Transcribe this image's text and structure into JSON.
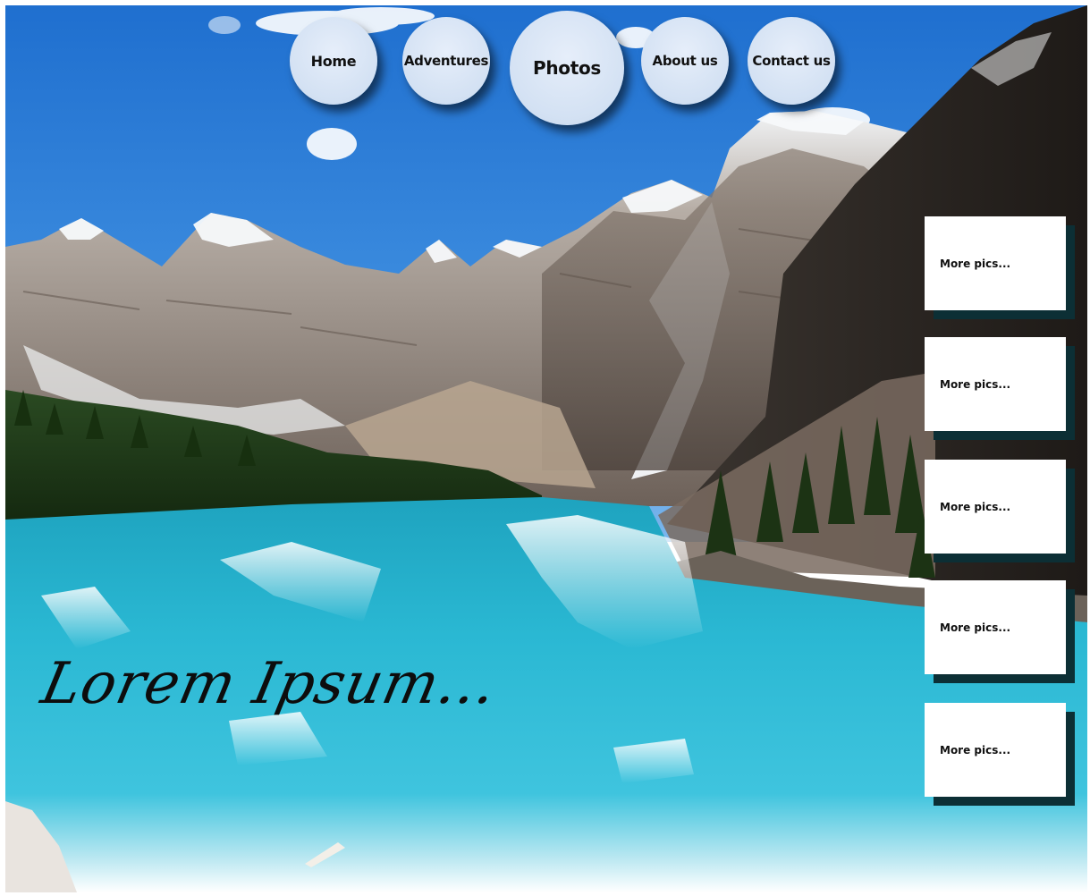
{
  "nav": {
    "items": [
      {
        "label": "Home",
        "active": false
      },
      {
        "label": "Adventures",
        "active": false
      },
      {
        "label": "Photos",
        "active": true
      },
      {
        "label": "About us",
        "active": false
      },
      {
        "label": "Contact us",
        "active": false
      }
    ]
  },
  "hero": {
    "headline": "Lorem Ipsum..."
  },
  "side_panel": {
    "cards": [
      {
        "label": "More pics..."
      },
      {
        "label": "More pics..."
      },
      {
        "label": "More pics..."
      },
      {
        "label": "More pics..."
      },
      {
        "label": "More pics..."
      }
    ]
  },
  "colors": {
    "sky": "#2f7fd6",
    "lake": "#2bb8d2",
    "nav_button": "#d8e4f4",
    "card_shadow": "#0c2f35"
  }
}
